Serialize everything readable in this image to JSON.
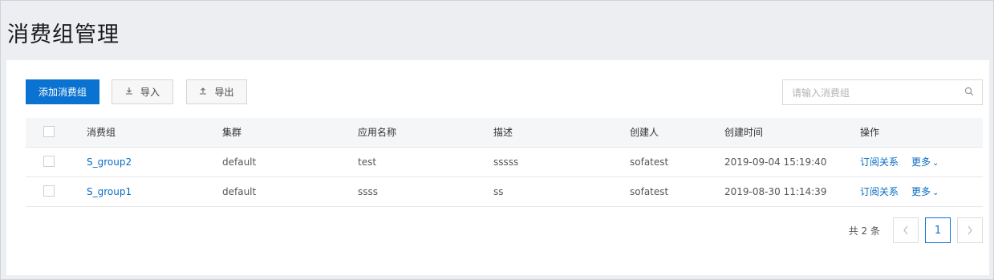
{
  "page": {
    "title": "消费组管理"
  },
  "toolbar": {
    "add_label": "添加消费组",
    "import_label": "导入",
    "export_label": "导出"
  },
  "search": {
    "placeholder": "请输入消费组",
    "value": ""
  },
  "table": {
    "headers": [
      "消费组",
      "集群",
      "应用名称",
      "描述",
      "创建人",
      "创建时间",
      "操作"
    ],
    "rows": [
      {
        "group": "S_group2",
        "cluster": "default",
        "app": "test",
        "desc": "sssss",
        "creator": "sofatest",
        "created": "2019-09-04 15:19:40",
        "action_subscribe": "订阅关系",
        "action_more": "更多"
      },
      {
        "group": "S_group1",
        "cluster": "default",
        "app": "ssss",
        "desc": "ss",
        "creator": "sofatest",
        "created": "2019-08-30 11:14:39",
        "action_subscribe": "订阅关系",
        "action_more": "更多"
      }
    ]
  },
  "pagination": {
    "total_text": "共 2 条",
    "current_page": "1"
  },
  "colors": {
    "primary": "#0a72d1",
    "link": "#0a6cc4"
  }
}
